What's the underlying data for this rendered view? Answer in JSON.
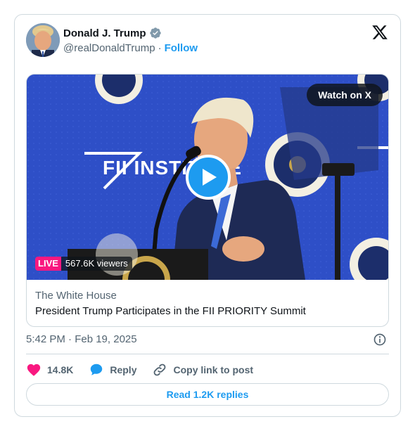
{
  "author": {
    "name": "Donald J. Trump",
    "handle": "@realDonaldTrump",
    "separator": "·",
    "follow_label": "Follow"
  },
  "media": {
    "watch_label": "Watch on X",
    "live_label": "LIVE",
    "viewers": "567.6K viewers",
    "source": "The White House",
    "title": "President Trump Participates in the FII PRIORITY Summit",
    "backdrop_text": "FII INSTITUTE"
  },
  "meta": {
    "timestamp": "5:42 PM · Feb 19, 2025"
  },
  "actions": {
    "likes": "14.8K",
    "reply_label": "Reply",
    "copy_label": "Copy link to post"
  },
  "replies_button": "Read 1.2K replies",
  "colors": {
    "accent": "#1d9bf0",
    "like": "#f91880",
    "live": "#f91880",
    "video_bg": "#2e4fc7"
  },
  "icons": [
    "verified-badge-icon",
    "x-logo-icon",
    "play-icon",
    "info-icon",
    "heart-icon",
    "reply-bubble-icon",
    "link-icon"
  ]
}
